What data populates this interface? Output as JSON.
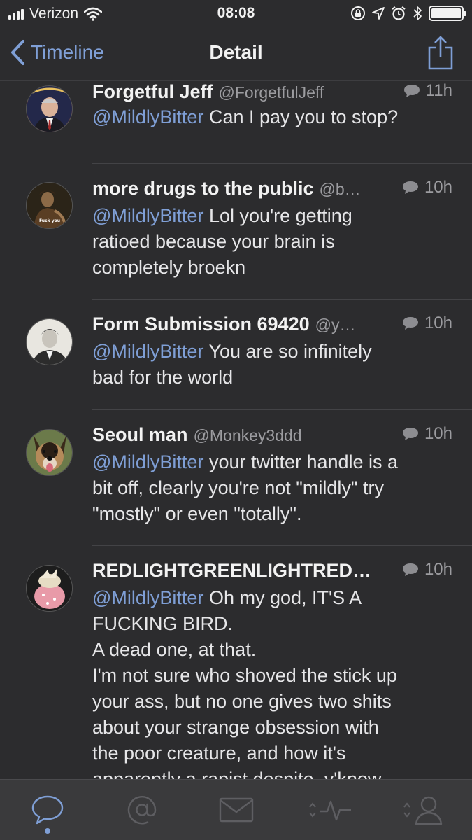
{
  "status_bar": {
    "carrier": "Verizon",
    "time": "08:08"
  },
  "nav": {
    "back_label": "Timeline",
    "title": "Detail"
  },
  "colors": {
    "background": "#2c2c2e",
    "accent": "#7f9fd6",
    "text": "#e6e6e8",
    "secondary_text": "#9c9ca0"
  },
  "tweets": [
    {
      "name": "Forgetful Jeff",
      "handle": "@ForgetfulJeff",
      "time": "11h",
      "mention": "@MildlyBitter",
      "text": " Can I pay you to stop?"
    },
    {
      "name": "more drugs to the public",
      "handle": "@b…",
      "time": "10h",
      "mention": "@MildlyBitter",
      "text": " Lol you're getting\nratioed because your brain is\ncompletely broekn",
      "avatar_caption": "Fuck you"
    },
    {
      "name": "Form Submission 69420",
      "handle": "@y…",
      "time": "10h",
      "mention": "@MildlyBitter",
      "text": " You are so infinitely\nbad for the world"
    },
    {
      "name": "Seoul man",
      "handle": "@Monkey3ddd",
      "time": "10h",
      "mention": "@MildlyBitter",
      "text": " your twitter handle is a\nbit off, clearly you're not \"mildly\" try\n\"mostly\" or even \"totally\"."
    },
    {
      "name": "REDLIGHTGREENLIGHTRED…",
      "handle": "",
      "time": "10h",
      "mention": "@MildlyBitter",
      "text": " Oh my god, IT'S A\nFUCKING BIRD.\nA dead one, at that.\nI'm not sure who shoved the stick up\nyour ass, but no one gives two shits\nabout your strange obsession with\nthe poor creature, and how it's\napparently a rapist despite, y'know"
    }
  ],
  "tab_bar": {
    "tabs": [
      {
        "icon": "speech-bubble-icon",
        "active": true
      },
      {
        "icon": "at-sign-icon",
        "active": false
      },
      {
        "icon": "envelope-icon",
        "active": false
      },
      {
        "icon": "activity-icon",
        "active": false
      },
      {
        "icon": "profile-icon",
        "active": false
      }
    ]
  }
}
